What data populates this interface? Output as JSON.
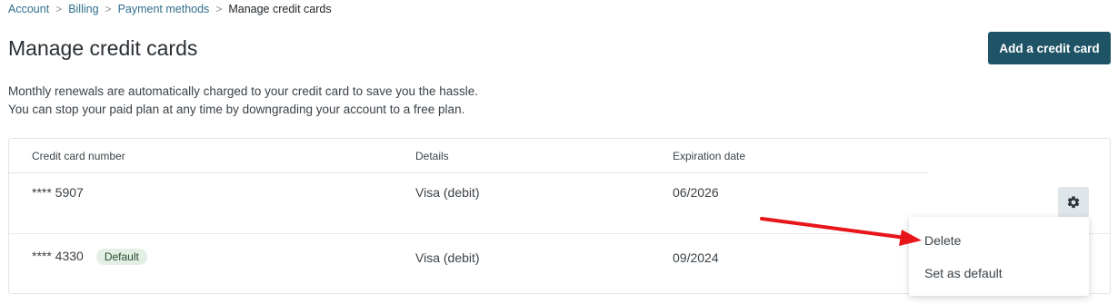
{
  "breadcrumb": {
    "items": [
      "Account",
      "Billing",
      "Payment methods"
    ],
    "current": "Manage credit cards",
    "separator_icon": "chevron-right-icon"
  },
  "page": {
    "title": "Manage credit cards",
    "add_button_label": "Add a credit card",
    "description_line1": "Monthly renewals are automatically charged to your credit card to save you the hassle.",
    "description_line2": "You can stop your paid plan at any time by downgrading your account to a free plan."
  },
  "table": {
    "headers": [
      "Credit card number",
      "Details",
      "Expiration date"
    ],
    "rows": [
      {
        "number": "**** 5907",
        "details": "Visa (debit)",
        "expiration": "06/2026",
        "badge": ""
      },
      {
        "number": "**** 4330",
        "details": "Visa (debit)",
        "expiration": "09/2024",
        "badge": "Default"
      }
    ],
    "actions_icon": "gear-icon"
  },
  "menu": {
    "items": [
      "Delete",
      "Set as default"
    ]
  },
  "colors": {
    "primary_button": "#1f5467",
    "link": "#2f6f8c",
    "badge_bg": "#e3efe4",
    "annotation_arrow": "#e8151b"
  }
}
